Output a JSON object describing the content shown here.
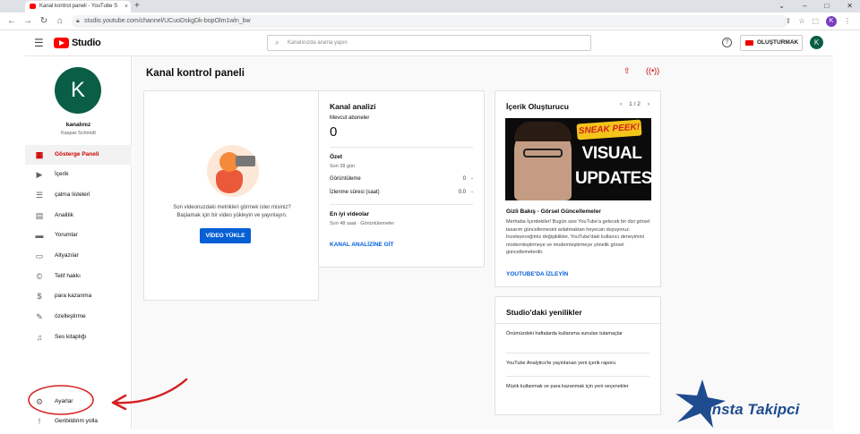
{
  "browser": {
    "tab_title": "Kanal kontrol paneli - YouTube S",
    "tab_close": "×",
    "new_tab": "+",
    "url": "studio.youtube.com/channel/UCuoDskgDk-bopOlm1wln_bw",
    "window_controls": [
      "⌄",
      "–",
      "□",
      "✕"
    ]
  },
  "header": {
    "logo_text": "Studio",
    "search_placeholder": "Kanalınızda arama yapın",
    "create_label": "OLUŞTURMAK",
    "avatar_letter": "K"
  },
  "sidebar": {
    "avatar_letter": "K",
    "channel_name": "kanalınız",
    "channel_owner": "Kaspar Schmidt",
    "items": [
      {
        "label": "Gösterge Paneli",
        "icon": "dashboard-icon",
        "glyph": "▦"
      },
      {
        "label": "İçerik",
        "icon": "content-icon",
        "glyph": "▶"
      },
      {
        "label": "çalma listeleri",
        "icon": "playlist-icon",
        "glyph": "☰"
      },
      {
        "label": "Analitik",
        "icon": "analytics-icon",
        "glyph": "▤"
      },
      {
        "label": "Yorumlar",
        "icon": "comments-icon",
        "glyph": "▬"
      },
      {
        "label": "Altyazılar",
        "icon": "subtitles-icon",
        "glyph": "▭"
      },
      {
        "label": "Telif hakkı",
        "icon": "copyright-icon",
        "glyph": "©"
      },
      {
        "label": "para kazanma",
        "icon": "monetization-icon",
        "glyph": "$"
      },
      {
        "label": "özelleştirme",
        "icon": "customization-icon",
        "glyph": "✎"
      },
      {
        "label": "Ses kitaplığı",
        "icon": "audio-library-icon",
        "glyph": "♫"
      },
      {
        "label": "Ayarlar",
        "icon": "gear-icon",
        "glyph": "⚙"
      },
      {
        "label": "Geribildirim yolla",
        "icon": "feedback-icon",
        "glyph": "!"
      }
    ]
  },
  "main": {
    "page_title": "Kanal kontrol paneli",
    "upload_card": {
      "text_line1": "Son videonuzdaki metrikleri görmek ister misiniz?",
      "text_line2": "Başlamak için bir video yükleyin ve yayınlayın.",
      "button_label": "VİDEO YÜKLE"
    },
    "analytics_card": {
      "title": "Kanal analizi",
      "subs_label": "Mevcut aboneler",
      "subs_value": "0",
      "summary_title": "Özet",
      "summary_period": "Son 28 gün",
      "views_label": "Görüntüleme",
      "views_value": "0",
      "views_trend": "-",
      "watch_label": "İzlenme süresi (saat)",
      "watch_value": "0.0",
      "watch_trend": "-",
      "top_videos_title": "En iyi videolar",
      "top_videos_sub": "Son 48 saat · Görüntülemeler",
      "link": "KANAL ANALİZİNE GİT"
    },
    "creator_card": {
      "title": "İçerik Oluşturucu",
      "pager": "1 / 2",
      "thumb_badge": "SNEAK PEEK!",
      "thumb_line1": "VISUAL",
      "thumb_line2": "UPDATES",
      "video_title": "Gizli Bakış - Görsel Güncellemeler",
      "description": "Merhaba İçerdekiler! Bugün size YouTube'a gelecek bir dizi görsel tasarım güncellemesini anlatmaktan heyecan duyuyoruz. İnceleyeceğimiz değişiklikler, YouTube'daki kullanıcı deneyimini modernleştirmeye ve modernleştirmeye yönelik görsel güncellemelerdir.",
      "link": "YOUTUBE'DA İZLEYİN"
    },
    "news_card": {
      "title": "Studio'daki yenilikler",
      "items": [
        "Önümüzdeki haftalarda kullanıma sunulan tutamaçlar",
        "YouTube Analytics'te yayınlanan yeni içerik raporu",
        "Müzik kullanmak ve para kazanmak için yeni seçenekler"
      ]
    }
  },
  "watermark": {
    "text": "Insta Takipci",
    "color": "#1f4c8f"
  },
  "colors": {
    "accent_red": "#cc0000",
    "link_blue": "#065fd4",
    "avatar_green": "#0a5e46"
  }
}
